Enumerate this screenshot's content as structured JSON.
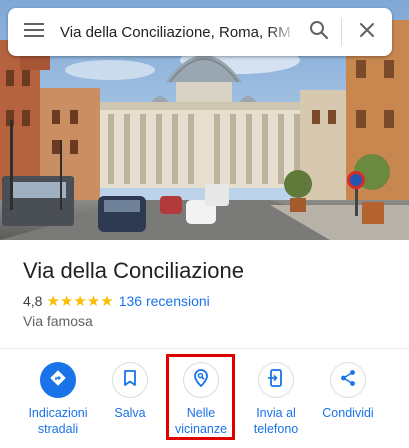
{
  "search": {
    "value": "Via della Conciliazione, Roma, RM",
    "menu_icon": "hamburger-menu-icon",
    "search_icon": "search-icon",
    "close_icon": "close-icon"
  },
  "place": {
    "photo": "st-peters-basilica-photo",
    "title": "Via della Conciliazione",
    "rating": "4,8",
    "stars": "★★★★★",
    "reviews": "136 recensioni",
    "category": "Via famosa"
  },
  "actions": [
    {
      "label": "Indicazioni\nstradali",
      "icon": "directions-icon",
      "primary": true
    },
    {
      "label": "Salva",
      "icon": "bookmark-icon"
    },
    {
      "label": "Nelle\nvicinanze",
      "icon": "nearby-icon",
      "highlighted": true
    },
    {
      "label": "Invia al\ntelefono",
      "icon": "send-to-phone-icon"
    },
    {
      "label": "Condividi",
      "icon": "share-icon"
    }
  ],
  "colors": {
    "accent": "#1a73e8",
    "star": "#fbbc04",
    "highlight": "#e00000"
  }
}
